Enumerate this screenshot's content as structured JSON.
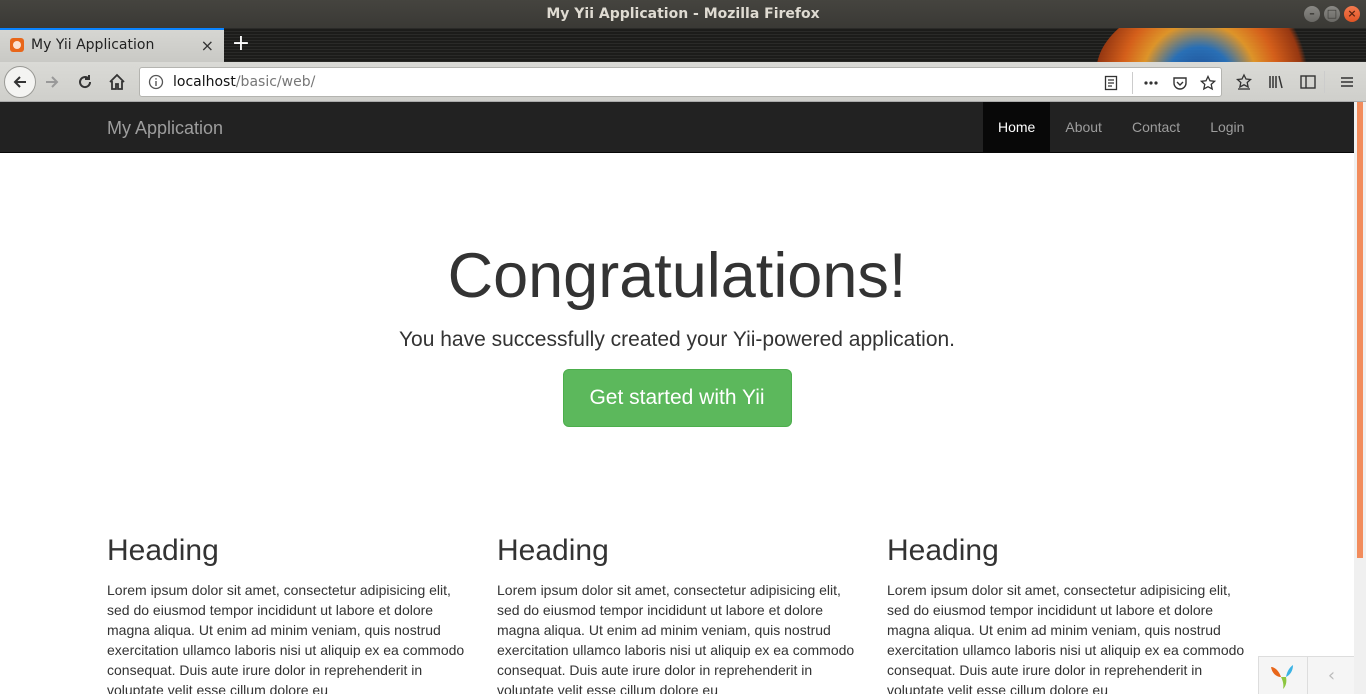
{
  "window": {
    "title": "My Yii Application - Mozilla Firefox"
  },
  "tab": {
    "label": "My Yii Application",
    "close": "×"
  },
  "urlbar": {
    "host": "localhost",
    "path": "/basic/web/"
  },
  "site": {
    "brand": "My Application",
    "nav": [
      {
        "label": "Home",
        "active": true
      },
      {
        "label": "About",
        "active": false
      },
      {
        "label": "Contact",
        "active": false
      },
      {
        "label": "Login",
        "active": false
      }
    ]
  },
  "jumbotron": {
    "heading": "Congratulations!",
    "lead": "You have successfully created your Yii-powered application.",
    "button": "Get started with Yii"
  },
  "columns": [
    {
      "heading": "Heading",
      "body": "Lorem ipsum dolor sit amet, consectetur adipisicing elit, sed do eiusmod tempor incididunt ut labore et dolore magna aliqua. Ut enim ad minim veniam, quis nostrud exercitation ullamco laboris nisi ut aliquip ex ea commodo consequat. Duis aute irure dolor in reprehenderit in voluptate velit esse cillum dolore eu"
    },
    {
      "heading": "Heading",
      "body": "Lorem ipsum dolor sit amet, consectetur adipisicing elit, sed do eiusmod tempor incididunt ut labore et dolore magna aliqua. Ut enim ad minim veniam, quis nostrud exercitation ullamco laboris nisi ut aliquip ex ea commodo consequat. Duis aute irure dolor in reprehenderit in voluptate velit esse cillum dolore eu"
    },
    {
      "heading": "Heading",
      "body": "Lorem ipsum dolor sit amet, consectetur adipisicing elit, sed do eiusmod tempor incididunt ut labore et dolore magna aliqua. Ut enim ad minim veniam, quis nostrud exercitation ullamco laboris nisi ut aliquip ex ea commodo consequat. Duis aute irure dolor in reprehenderit in voluptate velit esse cillum dolore eu"
    }
  ],
  "debugbar": {
    "chevron": "‹"
  },
  "colors": {
    "navbar": "#222222",
    "success": "#5cb85c",
    "firefox_accent": "#0a84ff",
    "scroll_thumb": "#f28c5c"
  }
}
